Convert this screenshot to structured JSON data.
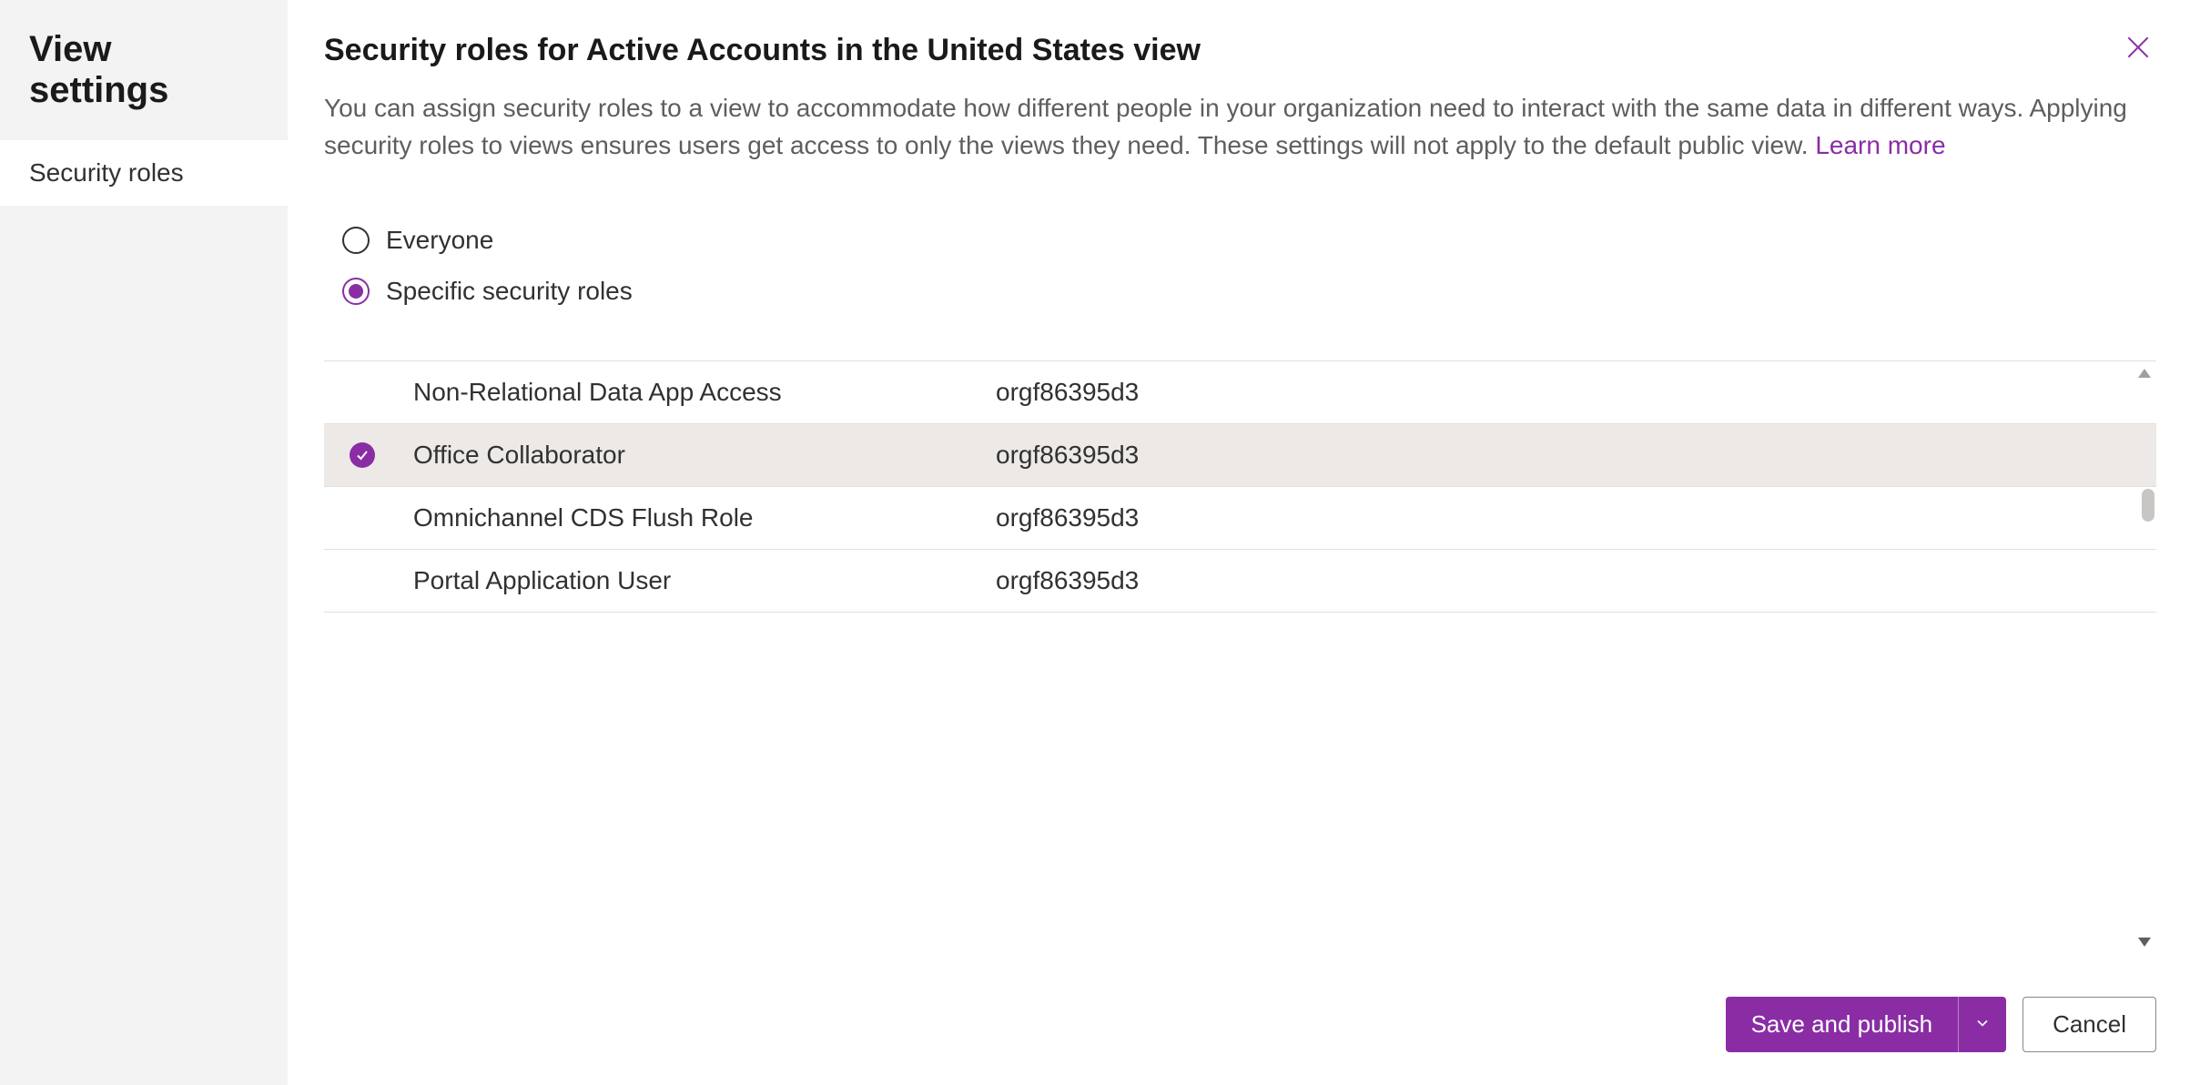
{
  "sidebar": {
    "title": "View settings",
    "items": [
      {
        "label": "Security roles",
        "active": true
      }
    ]
  },
  "main": {
    "title": "Security roles for Active Accounts in the United States view",
    "description_before_link": "You can assign security roles to a view to accommodate how different people in your organization need to interact with the same data in different ways. Applying security roles to views ensures users get access to only the views they need. These settings will not apply to the default public view. ",
    "learn_more_label": "Learn more"
  },
  "scope": {
    "options": [
      {
        "label": "Everyone",
        "selected": false
      },
      {
        "label": "Specific security roles",
        "selected": true
      }
    ]
  },
  "roles": {
    "rows": [
      {
        "name": "Non-Relational Data App Access",
        "org": "orgf86395d3",
        "selected": false
      },
      {
        "name": "Office Collaborator",
        "org": "orgf86395d3",
        "selected": true
      },
      {
        "name": "Omnichannel CDS Flush Role",
        "org": "orgf86395d3",
        "selected": false
      },
      {
        "name": "Portal Application User",
        "org": "orgf86395d3",
        "selected": false
      }
    ]
  },
  "footer": {
    "save_label": "Save and publish",
    "cancel_label": "Cancel"
  },
  "colors": {
    "accent": "#8a2da5"
  }
}
